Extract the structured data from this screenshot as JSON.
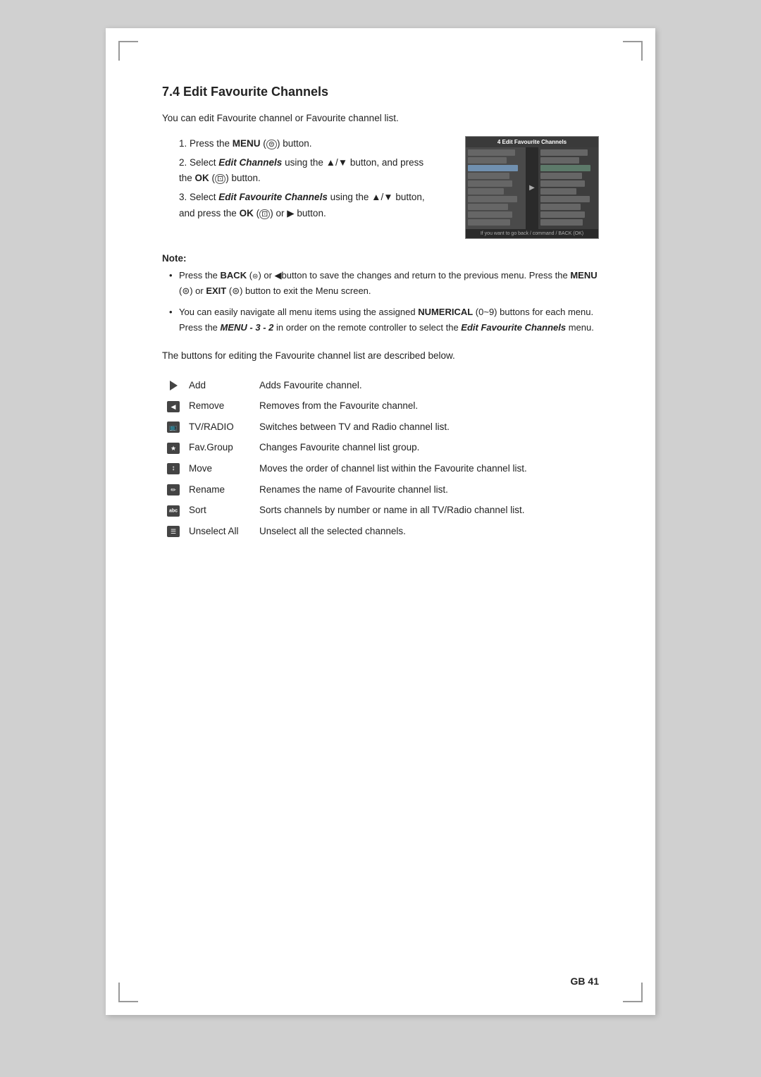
{
  "page": {
    "number": "GB 41",
    "background": "#ffffff"
  },
  "section": {
    "title": "7.4 Edit Favourite Channels",
    "intro": "You can edit Favourite channel or Favourite channel list.",
    "steps": [
      {
        "num": "1",
        "text_before": "Press the ",
        "bold": "MENU",
        "icon": "menu-icon",
        "text_after": " button."
      },
      {
        "num": "2",
        "text_before": "Select ",
        "bold_italic": "Edit Channels",
        "text_mid": " using the ▲/▼ button, and press the ",
        "bold2": "OK",
        "icon2": "ok-icon",
        "text_after": " button."
      },
      {
        "num": "3",
        "text_before": "Select ",
        "bold_italic": "Edit Favourite Channels",
        "text_mid": " using the ▲/▼ button, and press the ",
        "bold2": "OK",
        "icon2": "ok2-icon",
        "text_after": " or ▶ button."
      }
    ],
    "note_title": "Note:",
    "notes": [
      "Press the BACK ( ) or ◀button to save the changes and return to the previous menu. Press the MENU (⊜) or EXIT (⊜) button to exit the Menu screen.",
      "You can easily navigate all menu items using the assigned NUMERICAL (0~9) buttons for each menu. Press the MENU - 3 - 2 in order on the remote controller to select the Edit Favourite Channels menu."
    ],
    "desc": "The buttons for editing the Favourite channel list are described below.",
    "buttons": [
      {
        "icon_type": "triangle",
        "label": "Add",
        "description": "Adds Favourite channel."
      },
      {
        "icon_type": "remove",
        "label": "Remove",
        "description": "Removes from the Favourite channel."
      },
      {
        "icon_type": "tv",
        "label": "TV/RADIO",
        "description": "Switches between TV and Radio channel list."
      },
      {
        "icon_type": "fav",
        "label": "Fav.Group",
        "description": "Changes Favourite channel list group."
      },
      {
        "icon_type": "move",
        "label": "Move",
        "description": "Moves the order of channel list within the Favourite channel list."
      },
      {
        "icon_type": "rename",
        "label": "Rename",
        "description": "Renames the name of Favourite channel list."
      },
      {
        "icon_type": "sort",
        "label": "Sort",
        "description": "Sorts channels by number or name in all TV/Radio channel list."
      },
      {
        "icon_type": "unselect",
        "label": "Unselect All",
        "description": "Unselect all the selected channels."
      }
    ],
    "screenshot_title": "4 Edit Favourite Channels"
  }
}
